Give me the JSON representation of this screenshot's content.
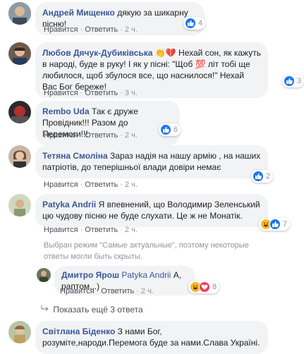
{
  "colors": {
    "author": "#385898",
    "bubble": "#f2f3f5",
    "like": "#1877f2",
    "haha": "#f7b928",
    "love": "#f33e58"
  },
  "comments": [
    {
      "author": "Андрей Мищенко",
      "text": "дякую за шикарну пісню!",
      "like": "Нравится",
      "reply": "Ответить",
      "time": "2 ч.",
      "reactions": [
        "like"
      ],
      "count": "4"
    },
    {
      "author": "Любов Дячук-Дубиківська",
      "text": "👏💔 Нехай сон, як кажуть в народі, буде в руку! І як у пісні: \"Щоб 💯 літ тобі ще любилося, щоб збулося все, що наснилося!\" Нехай Вас Бог береже!",
      "like": "Нравится",
      "reply": "Ответить",
      "time": "3 ч.",
      "reactions": [
        "like"
      ],
      "count": "3"
    },
    {
      "author": "Rembo Uda",
      "text": "Так є друже Провідник!!! Разом до Перемоги!!!",
      "like": "Нравится",
      "reply": "Ответить",
      "time": "2 ч.",
      "reactions": [
        "like"
      ],
      "count": "6"
    },
    {
      "author": "Тетяна Смоліна",
      "text": "Зараз надія на нашу армію , на наших патріотів, до теперішньої влади довіри немає",
      "like": "Нравится",
      "reply": "Ответить",
      "time": "2 ч.",
      "reactions": [
        "like"
      ],
      "count": "2"
    },
    {
      "author": "Patyka Andrii",
      "text": "Я впевнений, що Володимир Зеленський цю чудову пісню не буде слухати. Це ж не Монатік.",
      "like": "Нравится",
      "reply": "Ответить",
      "time": "2 ч.",
      "reactions": [
        "haha",
        "like"
      ],
      "count": "7"
    }
  ],
  "filter_note": "Выбран режим \"Самые актуальные\", поэтому некоторые ответы могли быть скрыты.",
  "reply": {
    "author": "Дмитро Ярош",
    "mention": "Patyka Andrii",
    "text": "А, раптом...)",
    "like": "Нравится",
    "reply": "Ответить",
    "time": "2 ч.",
    "reactions": [
      "haha",
      "love"
    ],
    "count": "8"
  },
  "show_more": "Показать ещё 3 ответа",
  "last_comment": {
    "author": "Світлана Біденко",
    "text": "З нами Бог, розуміте,народи.Перемога буде за нами.Слава Україні."
  }
}
